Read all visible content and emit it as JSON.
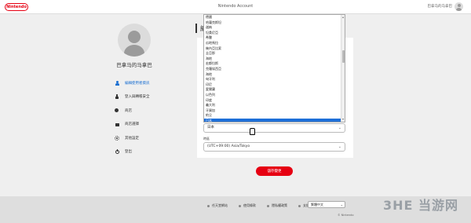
{
  "header": {
    "logo_text": "Nintendo",
    "title": "Nintendo Account",
    "username": "巴拿马的马拿巴"
  },
  "sidebar": {
    "name": "巴拿马的马拿巴",
    "items": [
      {
        "label": "編輯使用者資訊",
        "icon": "user-icon",
        "active": true
      },
      {
        "label": "登入與轉帳安全",
        "icon": "lock-icon",
        "active": false
      },
      {
        "label": "商店",
        "icon": "coin-icon",
        "active": false
      },
      {
        "label": "商店選擇",
        "icon": "bag-icon",
        "active": false
      },
      {
        "label": "其他設定",
        "icon": "gear-icon",
        "active": false
      },
      {
        "label": "登出",
        "icon": "power-icon",
        "active": false
      }
    ]
  },
  "main": {
    "title": "編",
    "country_dropdown": {
      "options": [
        "德國",
        "哈薩克斯坦",
        "迦納",
        "坦桑尼亞",
        "希臘",
        "瓜地馬拉",
        "幾內亞比索",
        "圭亞那",
        "海地",
        "宏都拉斯",
        "克羅埃西亞",
        "海地",
        "匈牙利",
        "印尼",
        "愛爾蘭",
        "以色列",
        "印度",
        "義大利",
        "牙買加",
        "約旦",
        "日本"
      ],
      "selected": "日本"
    },
    "country_value": "日本",
    "timezone_label": "時區",
    "timezone_value": "(UTC+09:00) Asia/Tokyo",
    "save_label": "儲存變更"
  },
  "footer": {
    "links": [
      "任天堂網站",
      "使用條款",
      "隱私權政策",
      "支援"
    ],
    "language": "繁體中文",
    "copyright": "© Nintendo"
  },
  "watermark": "3HE 当游网",
  "colors": {
    "accent": "#e60012",
    "link": "#1a6fd1",
    "selection": "#1e6fd8"
  }
}
